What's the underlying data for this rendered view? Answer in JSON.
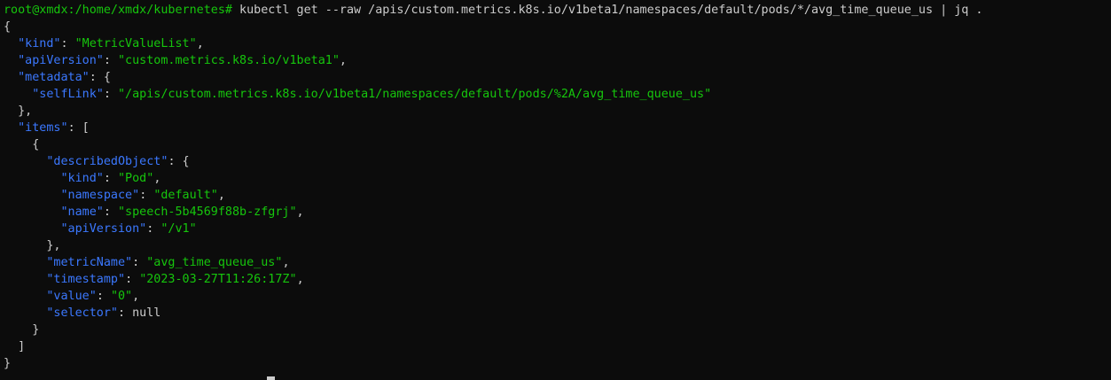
{
  "terminal": {
    "prompt": "root@xmdx:/home/xmdx/kubernetes#",
    "command": " kubectl get --raw /apis/custom.metrics.k8s.io/v1beta1/namespaces/default/pods/*/avg_time_queue_us | jq ."
  },
  "output": {
    "open_brace": "{",
    "kind_key": "\"kind\"",
    "kind_value": "\"MetricValueList\"",
    "apiVersion_key": "\"apiVersion\"",
    "apiVersion_value": "\"custom.metrics.k8s.io/v1beta1\"",
    "metadata_key": "\"metadata\"",
    "selfLink_key": "\"selfLink\"",
    "selfLink_value": "\"/apis/custom.metrics.k8s.io/v1beta1/namespaces/default/pods/%2A/avg_time_queue_us\"",
    "items_key": "\"items\"",
    "describedObject_key": "\"describedObject\"",
    "do_kind_key": "\"kind\"",
    "do_kind_value": "\"Pod\"",
    "do_namespace_key": "\"namespace\"",
    "do_namespace_value": "\"default\"",
    "do_name_key": "\"name\"",
    "do_name_value": "\"speech-5b4569f88b-zfgrj\"",
    "do_apiVersion_key": "\"apiVersion\"",
    "do_apiVersion_value": "\"/v1\"",
    "metricName_key": "\"metricName\"",
    "metricName_value": "\"avg_time_queue_us\"",
    "timestamp_key": "\"timestamp\"",
    "timestamp_value": "\"2023-03-27T11:26:17Z\"",
    "value_key": "\"value\"",
    "value_value": "\"0\"",
    "selector_key": "\"selector\"",
    "selector_value": "null",
    "close_brace": "}"
  },
  "colors": {
    "background": "#0c0c0c",
    "prompt_green": "#16c60c",
    "json_key_blue": "#3b78ff",
    "text_gray": "#cccccc"
  }
}
